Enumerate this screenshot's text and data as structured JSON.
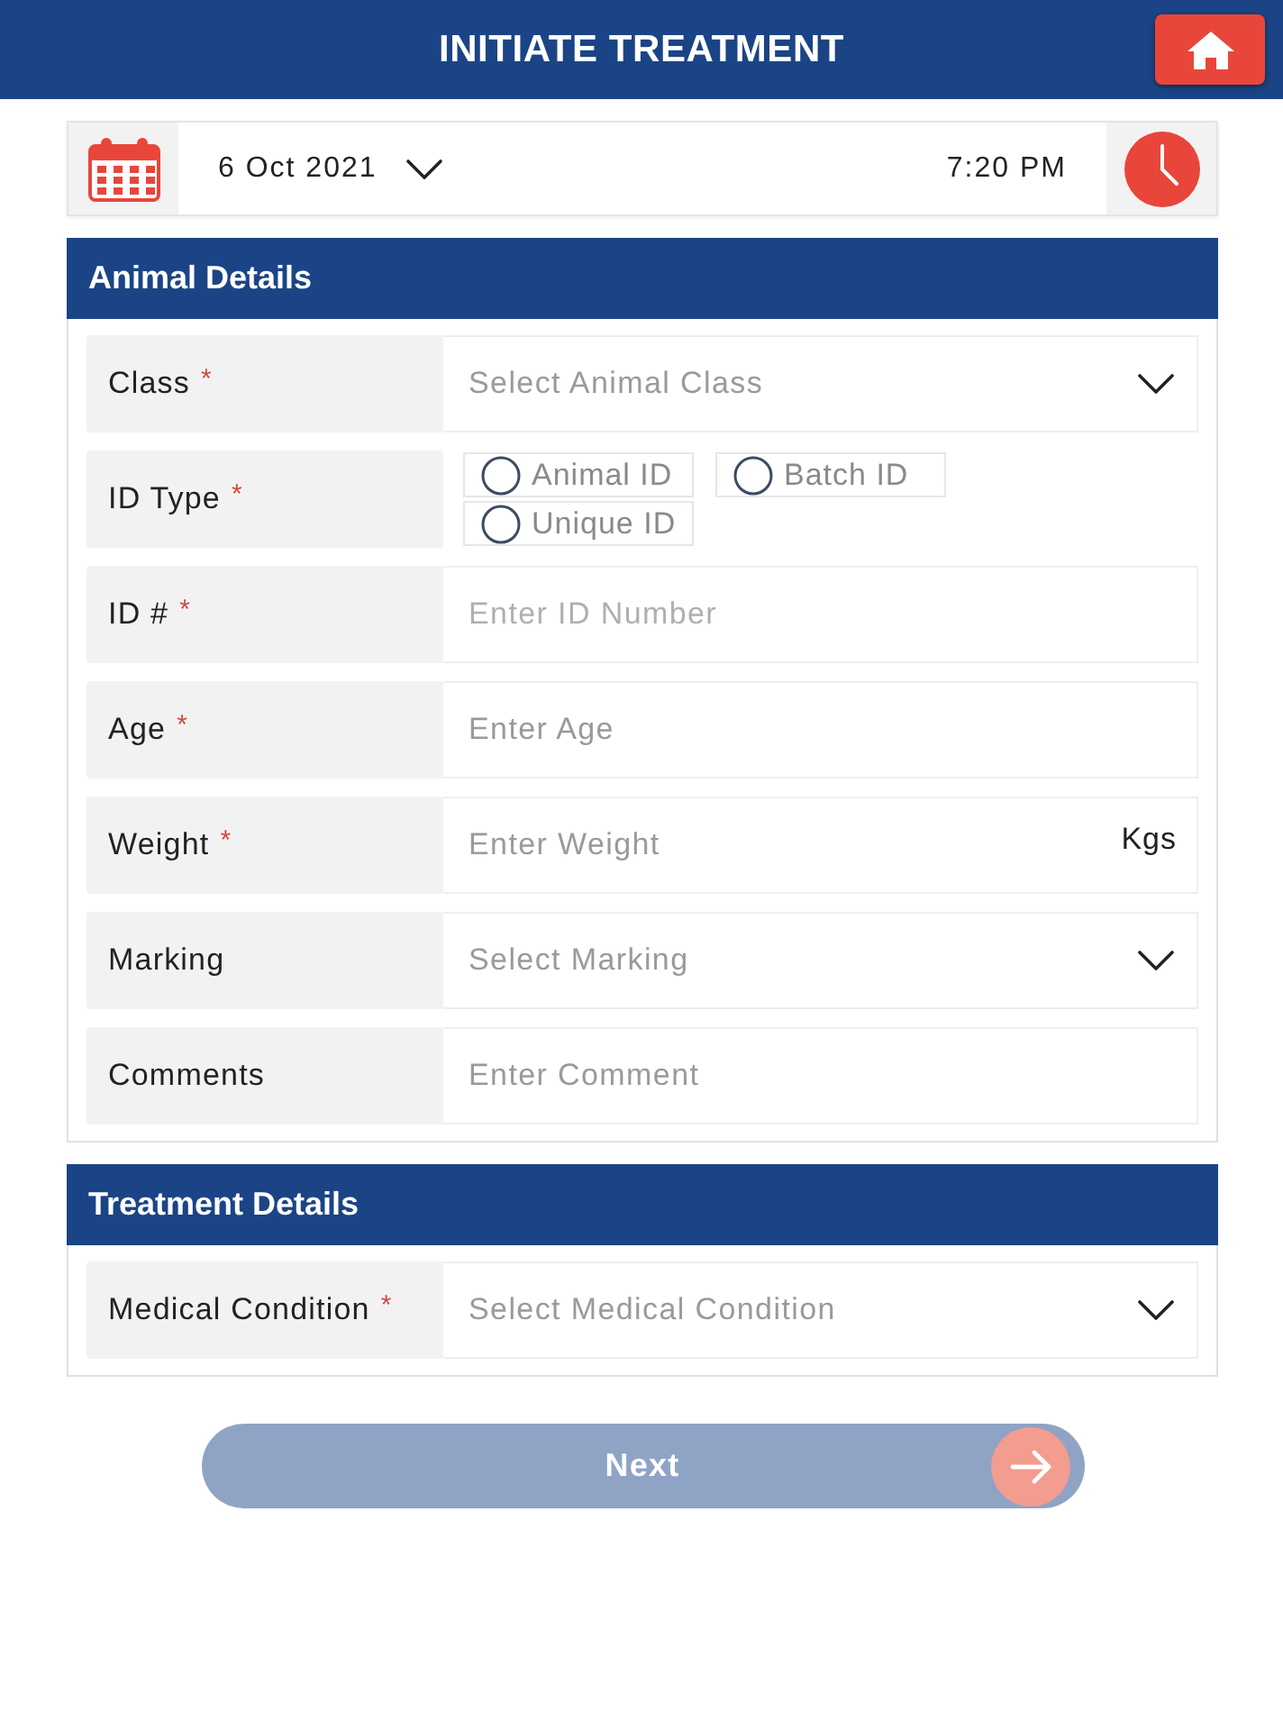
{
  "header": {
    "title": "INITIATE TREATMENT"
  },
  "date_bar": {
    "date": "6 Oct 2021",
    "time": "7:20 PM"
  },
  "sections": [
    {
      "title": "Animal Details",
      "fields": [
        {
          "kind": "select",
          "label": "Class",
          "required_mark": "*",
          "placeholder": "Select Animal Class",
          "disabled": false
        },
        {
          "kind": "radio",
          "label": "ID Type",
          "required_mark": "*",
          "options": [
            {
              "label": "Animal ID",
              "selected": false
            },
            {
              "label": "Batch ID",
              "selected": false
            },
            {
              "label": "Unique ID",
              "selected": false
            }
          ]
        },
        {
          "kind": "input",
          "label": "ID #",
          "required_mark": "*",
          "placeholder": "Enter ID Number",
          "disabled": true
        },
        {
          "kind": "input",
          "label": "Age",
          "required_mark": "*",
          "placeholder": "Enter Age",
          "disabled": false
        },
        {
          "kind": "input",
          "label": "Weight",
          "required_mark": "*",
          "placeholder": "Enter Weight",
          "unit": "Kgs",
          "disabled": false
        },
        {
          "kind": "select",
          "label": "Marking",
          "placeholder": "Select Marking",
          "disabled": false
        },
        {
          "kind": "input",
          "label": "Comments",
          "placeholder": "Enter Comment",
          "disabled": false
        }
      ]
    },
    {
      "title": "Treatment Details",
      "fields": [
        {
          "kind": "select",
          "label": "Medical Condition",
          "required_mark": "*",
          "placeholder": "Select Medical Condition",
          "disabled": false
        }
      ]
    }
  ],
  "next_button": {
    "label": "Next",
    "disabled": true
  }
}
